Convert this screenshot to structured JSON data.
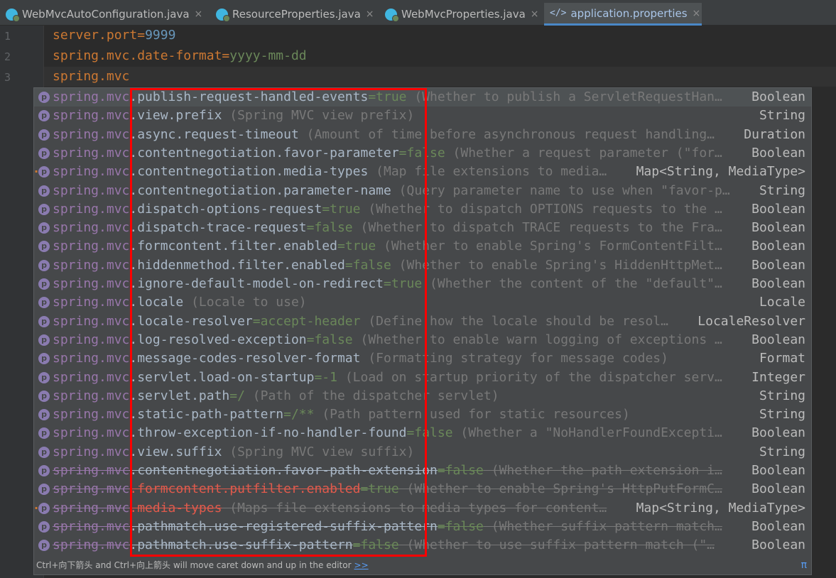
{
  "tabs": [
    {
      "label": "WebMvcAutoConfiguration.java",
      "icon": "java-class-icon",
      "close": "×"
    },
    {
      "label": "ResourceProperties.java",
      "icon": "java-class-icon",
      "close": "×"
    },
    {
      "label": "WebMvcProperties.java",
      "icon": "java-class-icon",
      "close": "×"
    },
    {
      "label": "application.properties",
      "icon": "properties-file-icon",
      "close": "×",
      "active": true
    }
  ],
  "tab_icons": {
    "properties": "</>"
  },
  "editor": {
    "line_numbers": [
      "1",
      "2",
      "3"
    ],
    "lines": [
      {
        "key": "server.port",
        "eq": "=",
        "value": "9999"
      },
      {
        "key": "spring.mvc.date-format",
        "eq": "=",
        "value": "yyyy-mm-dd"
      },
      {
        "key": "spring.mvc",
        "eq": "",
        "value": ""
      }
    ]
  },
  "completion": {
    "items": [
      {
        "prefix": "spring.mvc",
        "name": ".publish-request-handled-events",
        "def": "=true",
        "desc": " (Whether to publish a ServletRequestHan…",
        "type": "Boolean",
        "deprecated": false
      },
      {
        "prefix": "spring.mvc",
        "name": ".view.prefix",
        "def": "",
        "desc": " (Spring MVC view prefix)",
        "type": "String",
        "deprecated": false
      },
      {
        "prefix": "spring.mvc",
        "name": ".async.request-timeout",
        "def": "",
        "desc": " (Amount of time before asynchronous request handling…",
        "type": "Duration",
        "deprecated": false
      },
      {
        "prefix": "spring.mvc",
        "name": ".contentnegotiation.favor-parameter",
        "def": "=false",
        "desc": " (Whether a request parameter (\"for…",
        "type": "Boolean",
        "deprecated": false
      },
      {
        "prefix": "spring.mvc",
        "name": ".contentnegotiation.media-types",
        "def": "",
        "desc": " (Map file extensions to media…",
        "type": "Map<String, MediaType>",
        "deprecated": false,
        "mark": true
      },
      {
        "prefix": "spring.mvc",
        "name": ".contentnegotiation.parameter-name",
        "def": "",
        "desc": " (Query parameter name to use when \"favor-p…",
        "type": "String",
        "deprecated": false
      },
      {
        "prefix": "spring.mvc",
        "name": ".dispatch-options-request",
        "def": "=true",
        "desc": " (Whether to dispatch OPTIONS requests to the …",
        "type": "Boolean",
        "deprecated": false
      },
      {
        "prefix": "spring.mvc",
        "name": ".dispatch-trace-request",
        "def": "=false",
        "desc": " (Whether to dispatch TRACE requests to the Fra…",
        "type": "Boolean",
        "deprecated": false
      },
      {
        "prefix": "spring.mvc",
        "name": ".formcontent.filter.enabled",
        "def": "=true",
        "desc": " (Whether to enable Spring's FormContentFilt…",
        "type": "Boolean",
        "deprecated": false
      },
      {
        "prefix": "spring.mvc",
        "name": ".hiddenmethod.filter.enabled",
        "def": "=false",
        "desc": " (Whether to enable Spring's HiddenHttpMet…",
        "type": "Boolean",
        "deprecated": false
      },
      {
        "prefix": "spring.mvc",
        "name": ".ignore-default-model-on-redirect",
        "def": "=true",
        "desc": " (Whether the content of the \"default\"…",
        "type": "Boolean",
        "deprecated": false
      },
      {
        "prefix": "spring.mvc",
        "name": ".locale",
        "def": "",
        "desc": " (Locale to use)",
        "type": "Locale",
        "deprecated": false
      },
      {
        "prefix": "spring.mvc",
        "name": ".locale-resolver",
        "def": "=accept-header",
        "desc": " (Define how the locale should be resol…",
        "type": "LocaleResolver",
        "deprecated": false
      },
      {
        "prefix": "spring.mvc",
        "name": ".log-resolved-exception",
        "def": "=false",
        "desc": " (Whether to enable warn logging of exceptions …",
        "type": "Boolean",
        "deprecated": false
      },
      {
        "prefix": "spring.mvc",
        "name": ".message-codes-resolver-format",
        "def": "",
        "desc": " (Formatting strategy for message codes)",
        "type": "Format",
        "deprecated": false
      },
      {
        "prefix": "spring.mvc",
        "name": ".servlet.load-on-startup",
        "def": "=-1",
        "desc": " (Load on startup priority of the dispatcher serv…",
        "type": "Integer",
        "deprecated": false
      },
      {
        "prefix": "spring.mvc",
        "name": ".servlet.path",
        "def": "=/",
        "desc": " (Path of the dispatcher servlet)",
        "type": "String",
        "deprecated": false
      },
      {
        "prefix": "spring.mvc",
        "name": ".static-path-pattern",
        "def": "=/**",
        "desc": " (Path pattern used for static resources)",
        "type": "String",
        "deprecated": false
      },
      {
        "prefix": "spring.mvc",
        "name": ".throw-exception-if-no-handler-found",
        "def": "=false",
        "desc": " (Whether a \"NoHandlerFoundExcepti…",
        "type": "Boolean",
        "deprecated": false
      },
      {
        "prefix": "spring.mvc",
        "name": ".view.suffix",
        "def": "",
        "desc": " (Spring MVC view suffix)",
        "type": "String",
        "deprecated": false
      },
      {
        "prefix": "spring.mvc",
        "name": ".contentnegotiation.favor-path-extension",
        "def": "=false",
        "desc": " (Whether the path extension i…",
        "type": "Boolean",
        "deprecated": true
      },
      {
        "prefix": "spring.mvc",
        "name": ".formcontent.putfilter.enabled",
        "def": "=true",
        "desc": " (Whether to enable Spring's HttpPutFormC…",
        "type": "Boolean",
        "deprecated": true,
        "warn": true
      },
      {
        "prefix": "spring.mvc",
        "name": ".media-types",
        "def": "",
        "desc": " (Maps file extensions to media types for content…",
        "type": "Map<String, MediaType>",
        "deprecated": true,
        "warn": true,
        "mark": true
      },
      {
        "prefix": "spring.mvc",
        "name": ".pathmatch.use-registered-suffix-pattern",
        "def": "=false",
        "desc": " (Whether suffix pattern match…",
        "type": "Boolean",
        "deprecated": true
      },
      {
        "prefix": "spring.mvc",
        "name": ".pathmatch.use-suffix-pattern",
        "def": "=false",
        "desc": " (Whether to use suffix pattern match (\"…",
        "type": "Boolean",
        "deprecated": true
      }
    ],
    "hint": "Ctrl+向下箭头 and Ctrl+向上箭头 will move caret down and up in the editor",
    "hint_link": ">>",
    "pi_label": "π",
    "item_icon": "p"
  }
}
